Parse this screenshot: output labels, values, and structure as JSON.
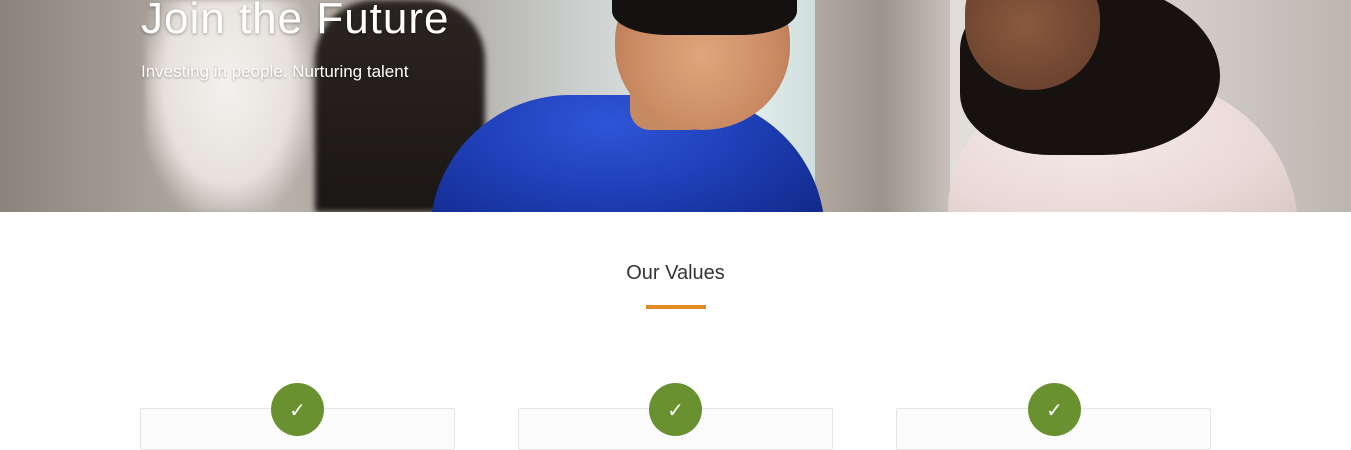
{
  "hero": {
    "title": "Join the Future",
    "subtitle": "Investing in people. Nurturing talent"
  },
  "values": {
    "heading": "Our Values",
    "divider_color": "#e28a25",
    "badge_color": "#6a9130",
    "cards": [
      {
        "icon": "check-icon",
        "glyph": "✓"
      },
      {
        "icon": "check-icon",
        "glyph": "✓"
      },
      {
        "icon": "check-icon",
        "glyph": "✓"
      }
    ]
  }
}
